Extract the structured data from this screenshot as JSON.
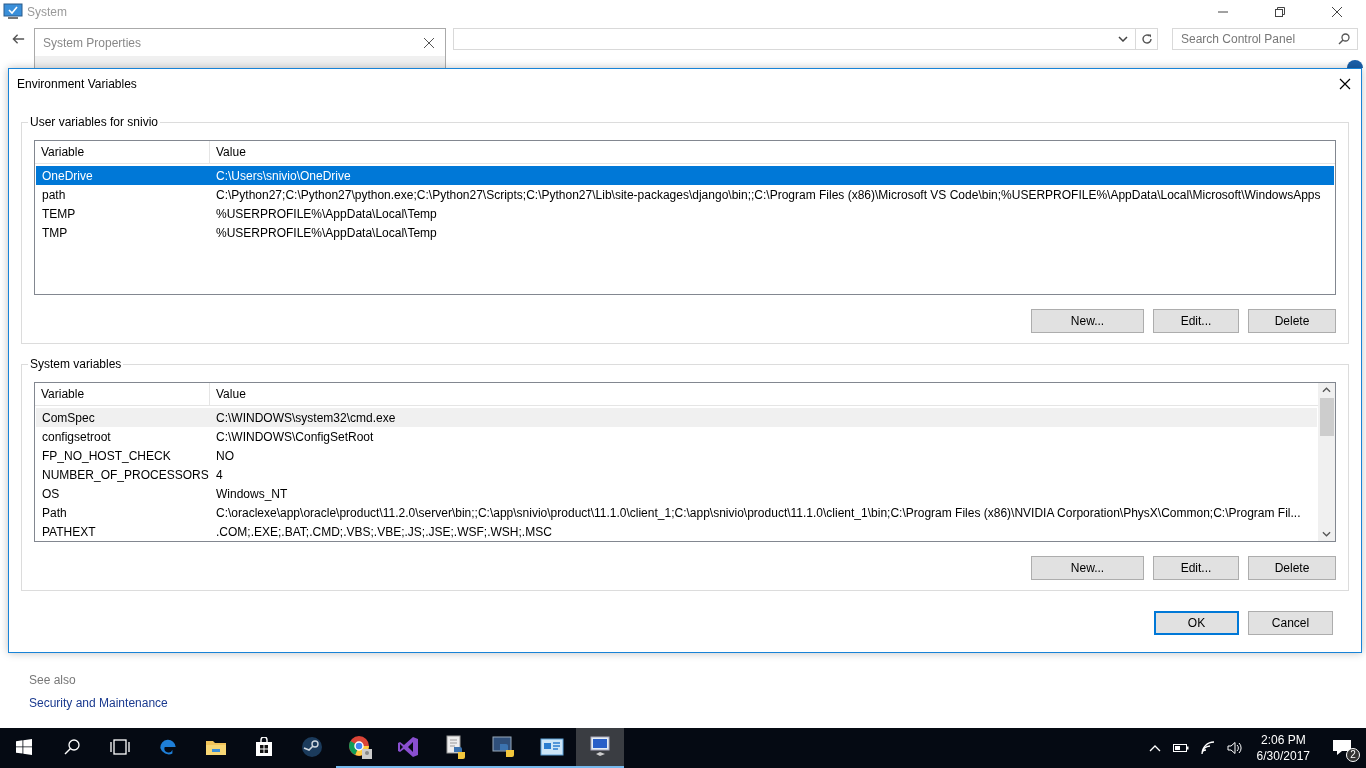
{
  "background_window": {
    "title": "System",
    "search": {
      "placeholder": "Search Control Panel"
    }
  },
  "system_properties": {
    "title": "System Properties"
  },
  "dialog": {
    "title": "Environment Variables",
    "user_group": {
      "label": "User variables for snivio",
      "focused": true,
      "columns": [
        "Variable",
        "Value"
      ],
      "rows": [
        {
          "variable": "OneDrive",
          "value": "C:\\Users\\snivio\\OneDrive",
          "selected": true
        },
        {
          "variable": "path",
          "value": "C:\\Python27;C:\\Python27\\python.exe;C:\\Python27\\Scripts;C:\\Python27\\Lib\\site-packages\\django\\bin;;C:\\Program Files (x86)\\Microsoft VS Code\\bin;%USERPROFILE%\\AppData\\Local\\Microsoft\\WindowsApps",
          "selected": false
        },
        {
          "variable": "TEMP",
          "value": "%USERPROFILE%\\AppData\\Local\\Temp",
          "selected": false
        },
        {
          "variable": "TMP",
          "value": "%USERPROFILE%\\AppData\\Local\\Temp",
          "selected": false
        }
      ],
      "buttons": [
        "New...",
        "Edit...",
        "Delete"
      ]
    },
    "system_group": {
      "label": "System variables",
      "focused": false,
      "columns": [
        "Variable",
        "Value"
      ],
      "rows": [
        {
          "variable": "ComSpec",
          "value": "C:\\WINDOWS\\system32\\cmd.exe",
          "selected": true
        },
        {
          "variable": "configsetroot",
          "value": "C:\\WINDOWS\\ConfigSetRoot",
          "selected": false
        },
        {
          "variable": "FP_NO_HOST_CHECK",
          "value": "NO",
          "selected": false
        },
        {
          "variable": "NUMBER_OF_PROCESSORS",
          "value": "4",
          "selected": false
        },
        {
          "variable": "OS",
          "value": "Windows_NT",
          "selected": false
        },
        {
          "variable": "Path",
          "value": "C:\\oraclexe\\app\\oracle\\product\\11.2.0\\server\\bin;;C:\\app\\snivio\\product\\11.1.0\\client_1;C:\\app\\snivio\\product\\11.1.0\\client_1\\bin;C:\\Program Files (x86)\\NVIDIA Corporation\\PhysX\\Common;C:\\Program Fil...",
          "selected": false
        },
        {
          "variable": "PATHEXT",
          "value": ".COM;.EXE;.BAT;.CMD;.VBS;.VBE;.JS;.JSE;.WSF;.WSH;.MSC",
          "selected": false
        }
      ],
      "buttons": [
        "New...",
        "Edit...",
        "Delete"
      ]
    },
    "buttons": [
      {
        "label": "OK",
        "default": true
      },
      {
        "label": "Cancel",
        "default": false
      }
    ]
  },
  "see_also": {
    "heading": "See also",
    "links": [
      "Security and Maintenance"
    ]
  },
  "taskbar": {
    "apps": [
      {
        "kind": "start",
        "running": false,
        "active": false
      },
      {
        "kind": "search",
        "running": false,
        "active": false
      },
      {
        "kind": "task-view",
        "running": false,
        "active": false
      },
      {
        "kind": "edge",
        "running": false,
        "active": false
      },
      {
        "kind": "explorer",
        "running": false,
        "active": false
      },
      {
        "kind": "store",
        "running": false,
        "active": false
      },
      {
        "kind": "steam",
        "running": false,
        "active": false
      },
      {
        "kind": "chrome",
        "running": true,
        "active": false
      },
      {
        "kind": "visual-studio",
        "running": true,
        "active": false
      },
      {
        "kind": "python-doc",
        "running": true,
        "active": false
      },
      {
        "kind": "python-shell",
        "running": true,
        "active": false
      },
      {
        "kind": "control-panel",
        "running": true,
        "active": false
      },
      {
        "kind": "system",
        "running": true,
        "active": true
      }
    ],
    "time": "2:06 PM",
    "date": "6/30/2017",
    "notifications": "2"
  }
}
